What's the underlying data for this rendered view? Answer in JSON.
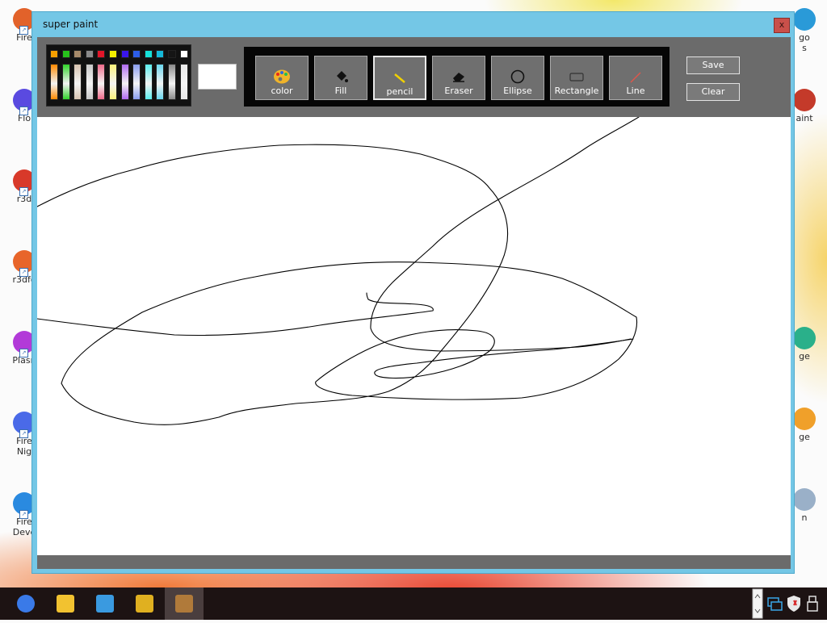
{
  "window": {
    "title": "super paint",
    "close_label": "x"
  },
  "palette": {
    "top_row": [
      "#f5a000",
      "#27c21b",
      "#a78a6a",
      "#8a8a8a",
      "#e2162a",
      "#f4f000",
      "#3a16ea",
      "#2d5ee8",
      "#15e0d8",
      "#15b8d8",
      "#151515",
      "#ffffff"
    ],
    "bottom_row": [
      "#ff8a00",
      "#31d42a",
      "#d8c3b0",
      "#c8c8c8",
      "#f06a8a",
      "#fbf37a",
      "#b06af0",
      "#8a9ef0",
      "#5af0f0",
      "#6ad8f0",
      "#8a8a8a",
      "#e8e8e8"
    ],
    "current_color": "#ffffff"
  },
  "tools": [
    {
      "name": "color",
      "label": "color",
      "icon": "palette-icon",
      "active": false
    },
    {
      "name": "fill",
      "label": "Fill",
      "icon": "paint-bucket-icon",
      "active": false
    },
    {
      "name": "pencil",
      "label": "pencil",
      "icon": "pencil-icon",
      "active": true
    },
    {
      "name": "eraser",
      "label": "Eraser",
      "icon": "eraser-icon",
      "active": false
    },
    {
      "name": "ellipse",
      "label": "Ellipse",
      "icon": "ellipse-icon",
      "active": false
    },
    {
      "name": "rectangle",
      "label": "Rectangle",
      "icon": "rectangle-icon",
      "active": false
    },
    {
      "name": "line",
      "label": "Line",
      "icon": "line-icon",
      "active": false
    }
  ],
  "actions": {
    "save_label": "Save",
    "clear_label": "Clear"
  },
  "desktop_icons_left": [
    {
      "label": "Fire",
      "icon": "firefox-icon",
      "color": "#e2622a"
    },
    {
      "label": "Flo",
      "icon": "floorp-icon",
      "color": "#5a4ae0"
    },
    {
      "label": "r3d",
      "icon": "r3d-icon",
      "color": "#d8392a"
    },
    {
      "label": "r3dfo",
      "icon": "r3dfox-icon",
      "color": "#e8652a"
    },
    {
      "label": "Plasn",
      "icon": "plasma-icon",
      "color": "#b23ad8"
    },
    {
      "label": "Fire\nNig",
      "icon": "firefox-nightly-icon",
      "color": "#4a6ae8"
    },
    {
      "label": "Fire\nDeve",
      "icon": "firefox-dev-icon",
      "color": "#2a8ae0"
    }
  ],
  "desktop_icons_right": [
    {
      "label": "go\ns",
      "icon": "app-icon",
      "color": "#2a9ad8"
    },
    {
      "label": "aint",
      "icon": "paint-icon",
      "color": "#c43a2a"
    },
    {
      "label": "ge",
      "icon": "edge-icon",
      "color": "#2ab08a"
    },
    {
      "label": "ge",
      "icon": "edge-canary-icon",
      "color": "#f0a02a"
    },
    {
      "label": "n",
      "icon": "recycle-bin-icon",
      "color": "#9ab0c8"
    }
  ],
  "taskbar": {
    "apps": [
      {
        "name": "firefox",
        "icon": "firefox-icon",
        "color": "#3a7ae8",
        "active": false
      },
      {
        "name": "file-explorer",
        "icon": "folder-icon",
        "color": "#f2c230",
        "active": false
      },
      {
        "name": "visual-studio",
        "icon": "visual-studio-icon",
        "color": "#3a9ae0",
        "active": false
      },
      {
        "name": "paint-app",
        "icon": "paint-brush-icon",
        "color": "#e0b020",
        "active": false
      },
      {
        "name": "super-paint",
        "icon": "super-paint-icon",
        "color": "#b07a3a",
        "active": true
      }
    ]
  }
}
